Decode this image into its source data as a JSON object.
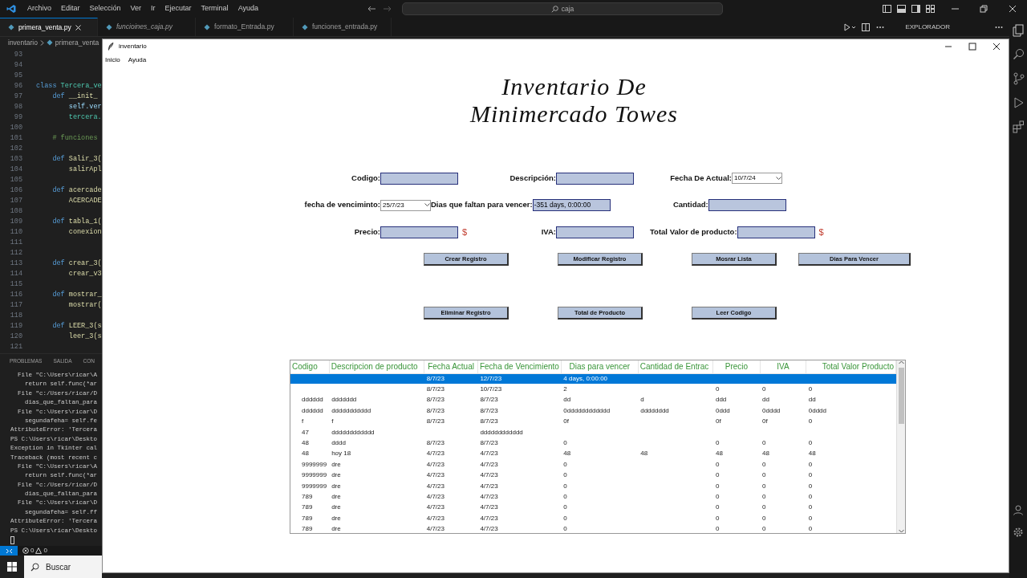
{
  "vscode": {
    "menu": [
      "Archivo",
      "Editar",
      "Selección",
      "Ver",
      "Ir",
      "Ejecutar",
      "Terminal",
      "Ayuda"
    ],
    "search": {
      "value": "caja"
    },
    "tabs": [
      {
        "label": "primera_venta.py",
        "selected": true,
        "preview": false
      },
      {
        "label": "funcioines_caja.py",
        "selected": false,
        "preview": true
      },
      {
        "label": "formato_Entrada.py",
        "selected": false,
        "preview": false
      },
      {
        "label": "funciones_entrada.py",
        "selected": false,
        "preview": false
      }
    ],
    "sidebar_title": "EXPLORADOR",
    "breadcrumb": [
      "inventario",
      "primera_venta"
    ],
    "code_lines": [
      {
        "number": "93"
      },
      {
        "number": "94"
      },
      {
        "number": "95"
      },
      {
        "number": "96",
        "tokens": [
          {
            "kind": "keyword",
            "text": "class "
          },
          {
            "kind": "type",
            "text": "Tercera_ve"
          }
        ]
      },
      {
        "number": "97",
        "tokens": [
          {
            "kind": "keyword",
            "text": "    def "
          },
          {
            "kind": "function",
            "text": "__init_"
          }
        ]
      },
      {
        "number": "98",
        "tokens": [
          {
            "kind": "variable",
            "text": "        self.ver"
          }
        ]
      },
      {
        "number": "99",
        "tokens": [
          {
            "kind": "type",
            "text": "        tercera."
          }
        ]
      },
      {
        "number": "100"
      },
      {
        "number": "101",
        "tokens": [
          {
            "kind": "comment",
            "text": "    # funciones"
          }
        ]
      },
      {
        "number": "102"
      },
      {
        "number": "103",
        "tokens": [
          {
            "kind": "keyword",
            "text": "    def "
          },
          {
            "kind": "function",
            "text": "Salir_3("
          }
        ]
      },
      {
        "number": "104",
        "tokens": [
          {
            "kind": "function",
            "text": "        salirApl"
          }
        ]
      },
      {
        "number": "105"
      },
      {
        "number": "106",
        "tokens": [
          {
            "kind": "keyword",
            "text": "    def "
          },
          {
            "kind": "function",
            "text": "acercade"
          }
        ]
      },
      {
        "number": "107",
        "tokens": [
          {
            "kind": "function",
            "text": "        ACERCADE"
          }
        ]
      },
      {
        "number": "108"
      },
      {
        "number": "109",
        "tokens": [
          {
            "kind": "keyword",
            "text": "    def "
          },
          {
            "kind": "function",
            "text": "tabla_1("
          }
        ]
      },
      {
        "number": "110",
        "tokens": [
          {
            "kind": "function",
            "text": "        conexion"
          }
        ]
      },
      {
        "number": "111"
      },
      {
        "number": "112"
      },
      {
        "number": "113",
        "tokens": [
          {
            "kind": "keyword",
            "text": "    def "
          },
          {
            "kind": "function",
            "text": "crear_3("
          }
        ]
      },
      {
        "number": "114",
        "tokens": [
          {
            "kind": "function",
            "text": "        crear_v3"
          }
        ]
      },
      {
        "number": "115"
      },
      {
        "number": "116",
        "tokens": [
          {
            "kind": "keyword",
            "text": "    def "
          },
          {
            "kind": "function",
            "text": "mostrar_"
          }
        ]
      },
      {
        "number": "117",
        "tokens": [
          {
            "kind": "function",
            "text": "        mostrar("
          }
        ]
      },
      {
        "number": "118"
      },
      {
        "number": "119",
        "tokens": [
          {
            "kind": "keyword",
            "text": "    def "
          },
          {
            "kind": "function",
            "text": "LEER_3(s"
          }
        ]
      },
      {
        "number": "120",
        "tokens": [
          {
            "kind": "function",
            "text": "        leer_3(s"
          }
        ]
      },
      {
        "number": "121"
      }
    ],
    "panel_tabs": [
      "PROBLEMAS",
      "SALIDA",
      "CON"
    ],
    "terminal_lines": [
      "  File \"C:\\Users\\ricar\\A",
      "    return self.func(*ar",
      "  File \"c:/Users/ricar/D",
      "    dias_que_faltan_para",
      "  File \"c:\\Users\\ricar\\D",
      "    segundafeha= self.fe",
      "AttributeError: 'Tercera",
      "PS C:\\Users\\ricar\\Deskto",
      "Exception in Tkinter cal",
      "Traceback (most recent c",
      "  File \"C:\\Users\\ricar\\A",
      "    return self.func(*ar",
      "  File \"c:/Users/ricar/D",
      "    dias_que_faltan_para",
      "  File \"c:\\Users\\ricar\\D",
      "    segundafeha= self.ff",
      "AttributeError: 'Tercera",
      "PS C:\\Users\\ricar\\Deskto"
    ],
    "status_bar": {
      "errors": "0",
      "warnings": "0"
    },
    "taskbar": {
      "search_placeholder": "Buscar"
    }
  },
  "window": {
    "title": "inventario",
    "menu": [
      "Inicio",
      "Ayuda"
    ],
    "heading": [
      "Inventario De",
      "Minimercado Towes"
    ],
    "form_rows": [
      [
        {
          "label": "Codigo:",
          "field": {
            "kind": "entry"
          }
        },
        {
          "label": "Descripción:",
          "field": {
            "kind": "entry"
          }
        },
        {
          "label": "Fecha De Actual:",
          "field": {
            "kind": "combo",
            "value": "10/7/24"
          }
        }
      ],
      [
        {
          "label": "fecha de venciminto:",
          "field": {
            "kind": "combo",
            "value": "25/7/23"
          }
        },
        {
          "label": "Dias que faltan para vencer:",
          "field": {
            "kind": "entry",
            "value": "-351 days, 0:00:00"
          }
        },
        {
          "label": "Cantidad:",
          "field": {
            "kind": "entry"
          }
        }
      ],
      [
        {
          "label": "Precio:",
          "field": {
            "kind": "entry"
          },
          "suffix": "$"
        },
        {
          "label": "IVA:",
          "field": {
            "kind": "entry"
          }
        },
        {
          "label": "Total Valor de producto:",
          "field": {
            "kind": "entry"
          },
          "suffix": "$"
        }
      ]
    ],
    "buttons": [
      [
        "Crear Registro",
        "Modificar Registro",
        "Mosrar Lista",
        "Dias Para Vencer"
      ],
      [
        "Eliminar Registro",
        "Total de Producto",
        "Leer Codigo"
      ]
    ],
    "table": {
      "columns": [
        "Codigo",
        "Descripcion de producto",
        "Fecha Actual",
        "Fecha de Vencimiento",
        "Dias para vencer",
        "Cantidad de Entrac",
        "Precio",
        "IVA",
        "Total Valor Producto"
      ],
      "rows": [
        {
          "selected": true,
          "cells": [
            null,
            null,
            "8/7/23",
            "12/7/23",
            "4 days, 0:00:00",
            null,
            null,
            null,
            null
          ]
        },
        {
          "selected": false,
          "cells": [
            null,
            null,
            "8/7/23",
            "10/7/23",
            "2",
            null,
            "0",
            "0",
            "0"
          ]
        },
        {
          "selected": false,
          "cells": [
            "dddddd",
            "ddddddd",
            "8/7/23",
            "8/7/23",
            "dd",
            "d",
            "ddd",
            "dd",
            "dd"
          ]
        },
        {
          "selected": false,
          "cells": [
            "dddddd",
            "ddddddddddd",
            "8/7/23",
            "8/7/23",
            "0dddddddddddd",
            "dddddddd",
            "0ddd",
            "0dddd",
            "0dddd"
          ]
        },
        {
          "selected": false,
          "cells": [
            "f",
            "f",
            "8/7/23",
            "8/7/23",
            "0f",
            null,
            "0f",
            "0f",
            "0"
          ]
        },
        {
          "selected": false,
          "cells": [
            "47",
            "dddddddddddd",
            null,
            "dddddddddddd",
            null,
            null,
            null,
            null,
            null
          ]
        },
        {
          "selected": false,
          "cells": [
            "48",
            "dddd",
            "8/7/23",
            "8/7/23",
            "0",
            null,
            "0",
            "0",
            "0"
          ]
        },
        {
          "selected": false,
          "cells": [
            "48",
            "hoy 18",
            "4/7/23",
            "4/7/23",
            "48",
            "48",
            "48",
            "48",
            "48"
          ]
        },
        {
          "selected": false,
          "cells": [
            "9999999",
            "dre",
            "4/7/23",
            "4/7/23",
            "0",
            null,
            "0",
            "0",
            "0"
          ]
        },
        {
          "selected": false,
          "cells": [
            "9999999",
            "dre",
            "4/7/23",
            "4/7/23",
            "0",
            null,
            "0",
            "0",
            "0"
          ]
        },
        {
          "selected": false,
          "cells": [
            "9999999",
            "dre",
            "4/7/23",
            "4/7/23",
            "0",
            null,
            "0",
            "0",
            "0"
          ]
        },
        {
          "selected": false,
          "cells": [
            "789",
            "dre",
            "4/7/23",
            "4/7/23",
            "0",
            null,
            "0",
            "0",
            "0"
          ]
        },
        {
          "selected": false,
          "cells": [
            "789",
            "dre",
            "4/7/23",
            "4/7/23",
            "0",
            null,
            "0",
            "0",
            "0"
          ]
        },
        {
          "selected": false,
          "cells": [
            "789",
            "dre",
            "4/7/23",
            "4/7/23",
            "0",
            null,
            "0",
            "0",
            "0"
          ]
        },
        {
          "selected": false,
          "cells": [
            "789",
            "dre",
            "4/7/23",
            "4/7/23",
            "0",
            null,
            "0",
            "0",
            "0"
          ]
        }
      ]
    }
  }
}
